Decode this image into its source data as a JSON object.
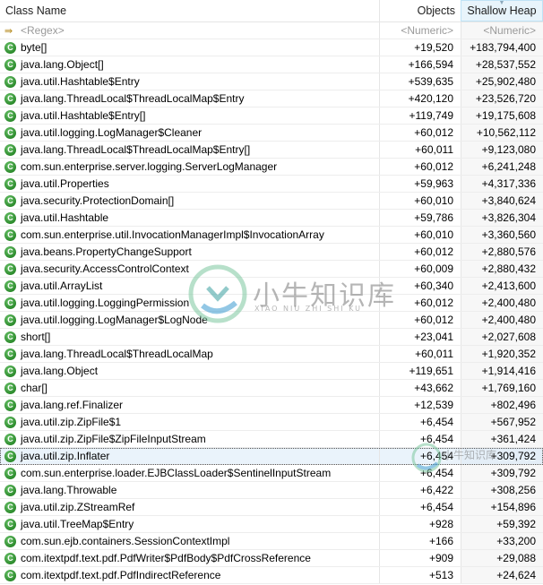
{
  "columns": {
    "class_name": "Class Name",
    "objects": "Objects",
    "shallow_heap": "Shallow Heap"
  },
  "filter_row": {
    "class_name_placeholder": "<Regex>",
    "objects_placeholder": "<Numeric>",
    "shallow_heap_placeholder": "<Numeric>"
  },
  "sorted_column": "Shallow Heap",
  "selected_row": "java.util.zip.Inflater",
  "rows": [
    {
      "name": "byte[]",
      "objects": "+19,520",
      "heap": "+183,794,400"
    },
    {
      "name": "java.lang.Object[]",
      "objects": "+166,594",
      "heap": "+28,537,552"
    },
    {
      "name": "java.util.Hashtable$Entry",
      "objects": "+539,635",
      "heap": "+25,902,480"
    },
    {
      "name": "java.lang.ThreadLocal$ThreadLocalMap$Entry",
      "objects": "+420,120",
      "heap": "+23,526,720"
    },
    {
      "name": "java.util.Hashtable$Entry[]",
      "objects": "+119,749",
      "heap": "+19,175,608"
    },
    {
      "name": "java.util.logging.LogManager$Cleaner",
      "objects": "+60,012",
      "heap": "+10,562,112"
    },
    {
      "name": "java.lang.ThreadLocal$ThreadLocalMap$Entry[]",
      "objects": "+60,011",
      "heap": "+9,123,080"
    },
    {
      "name": "com.sun.enterprise.server.logging.ServerLogManager",
      "objects": "+60,012",
      "heap": "+6,241,248"
    },
    {
      "name": "java.util.Properties",
      "objects": "+59,963",
      "heap": "+4,317,336"
    },
    {
      "name": "java.security.ProtectionDomain[]",
      "objects": "+60,010",
      "heap": "+3,840,624"
    },
    {
      "name": "java.util.Hashtable",
      "objects": "+59,786",
      "heap": "+3,826,304"
    },
    {
      "name": "com.sun.enterprise.util.InvocationManagerImpl$InvocationArray",
      "objects": "+60,010",
      "heap": "+3,360,560"
    },
    {
      "name": "java.beans.PropertyChangeSupport",
      "objects": "+60,012",
      "heap": "+2,880,576"
    },
    {
      "name": "java.security.AccessControlContext",
      "objects": "+60,009",
      "heap": "+2,880,432"
    },
    {
      "name": "java.util.ArrayList",
      "objects": "+60,340",
      "heap": "+2,413,600"
    },
    {
      "name": "java.util.logging.LoggingPermission",
      "objects": "+60,012",
      "heap": "+2,400,480"
    },
    {
      "name": "java.util.logging.LogManager$LogNode",
      "objects": "+60,012",
      "heap": "+2,400,480"
    },
    {
      "name": "short[]",
      "objects": "+23,041",
      "heap": "+2,027,608"
    },
    {
      "name": "java.lang.ThreadLocal$ThreadLocalMap",
      "objects": "+60,011",
      "heap": "+1,920,352"
    },
    {
      "name": "java.lang.Object",
      "objects": "+119,651",
      "heap": "+1,914,416"
    },
    {
      "name": "char[]",
      "objects": "+43,662",
      "heap": "+1,769,160"
    },
    {
      "name": "java.lang.ref.Finalizer",
      "objects": "+12,539",
      "heap": "+802,496"
    },
    {
      "name": "java.util.zip.ZipFile$1",
      "objects": "+6,454",
      "heap": "+567,952"
    },
    {
      "name": "java.util.zip.ZipFile$ZipFileInputStream",
      "objects": "+6,454",
      "heap": "+361,424"
    },
    {
      "name": "java.util.zip.Inflater",
      "objects": "+6,454",
      "heap": "+309,792"
    },
    {
      "name": "com.sun.enterprise.loader.EJBClassLoader$SentinelInputStream",
      "objects": "+6,454",
      "heap": "+309,792"
    },
    {
      "name": "java.lang.Throwable",
      "objects": "+6,422",
      "heap": "+308,256"
    },
    {
      "name": "java.util.zip.ZStreamRef",
      "objects": "+6,454",
      "heap": "+154,896"
    },
    {
      "name": "java.util.TreeMap$Entry",
      "objects": "+928",
      "heap": "+59,392"
    },
    {
      "name": "com.sun.ejb.containers.SessionContextImpl",
      "objects": "+166",
      "heap": "+33,200"
    },
    {
      "name": "com.itextpdf.text.pdf.PdfWriter$PdfBody$PdfCrossReference",
      "objects": "+909",
      "heap": "+29,088"
    },
    {
      "name": "com.itextpdf.text.pdf.PdfIndirectReference",
      "objects": "+513",
      "heap": "+24,624"
    }
  ],
  "icons": {
    "class": "class-icon",
    "class_glyph": "C",
    "regex": "regex-filter-icon",
    "regex_glyph": "⇛"
  },
  "watermark": {
    "text_cn": "小牛知识库",
    "text_pinyin": "XIAO NIU ZHI SHI KU"
  }
}
